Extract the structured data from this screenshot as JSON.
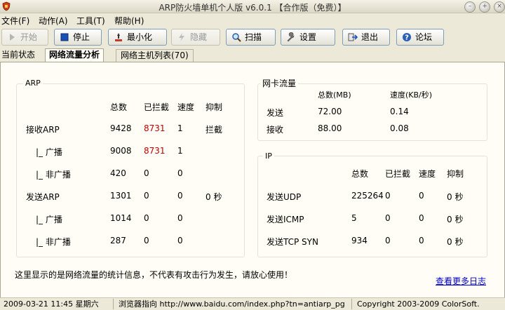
{
  "window": {
    "title": "ARP防火墙单机个人版 v6.0.1 【合作版（免费）】",
    "icons": [
      "shield-logo-icon",
      "minimize-icon",
      "maximize-icon",
      "close-icon"
    ]
  },
  "menu": [
    {
      "label": "文件(F)"
    },
    {
      "label": "动作(A)"
    },
    {
      "label": "工具(T)"
    },
    {
      "label": "帮助(H)"
    }
  ],
  "toolbar": [
    {
      "label": "开始",
      "icon": "play-icon",
      "enabled": false
    },
    {
      "label": "停止",
      "icon": "stop-icon",
      "enabled": true
    },
    {
      "label": "最小化",
      "icon": "minimize-to-tray-icon",
      "enabled": true
    },
    {
      "label": "隐藏",
      "icon": "hide-icon",
      "enabled": false
    },
    {
      "label": "扫描",
      "icon": "magnifier-icon",
      "enabled": true
    },
    {
      "label": "设置",
      "icon": "wrench-icon",
      "enabled": true
    },
    {
      "label": "退出",
      "icon": "exit-icon",
      "enabled": true
    },
    {
      "label": "论坛",
      "icon": "help-icon",
      "enabled": true
    }
  ],
  "tabs": [
    {
      "label": "当前状态",
      "active": false
    },
    {
      "label": "网络流量分析",
      "active": true
    },
    {
      "label": "网络主机列表(70)",
      "active": false
    }
  ],
  "arp": {
    "label": "ARP",
    "headers": [
      "总数",
      "已拦截",
      "速度",
      "抑制"
    ],
    "rows": [
      {
        "name": "接收ARP",
        "total": "9428",
        "blocked": "8731",
        "speed": "1",
        "suppress": "拦截"
      },
      {
        "name": "|_ 广播",
        "total": "9008",
        "blocked": "8731",
        "speed": "1",
        "suppress": ""
      },
      {
        "name": "|_ 非广播",
        "total": "420",
        "blocked": "0",
        "speed": "0",
        "suppress": ""
      },
      {
        "name": "发送ARP",
        "total": "1301",
        "blocked": "0",
        "speed": "0",
        "suppress": "0 秒"
      },
      {
        "name": "|_ 广播",
        "total": "1014",
        "blocked": "0",
        "speed": "0",
        "suppress": ""
      },
      {
        "name": "|_ 非广播",
        "total": "287",
        "blocked": "0",
        "speed": "0",
        "suppress": ""
      }
    ]
  },
  "nic": {
    "label": "网卡流量",
    "headers": [
      "总数(MB)",
      "速度(KB/秒)"
    ],
    "rows": [
      {
        "name": "发送",
        "total": "72.00",
        "speed": "0.14"
      },
      {
        "name": "接收",
        "total": "88.00",
        "speed": "0.08"
      }
    ]
  },
  "ip": {
    "label": "IP",
    "headers": [
      "总数",
      "已拦截",
      "速度",
      "抑制"
    ],
    "rows": [
      {
        "name": "发送UDP",
        "total": "225264",
        "blocked": "0",
        "speed": "0",
        "suppress": "0 秒"
      },
      {
        "name": "发送ICMP",
        "total": "5",
        "blocked": "0",
        "speed": "0",
        "suppress": "0 秒"
      },
      {
        "name": "发送TCP SYN",
        "total": "934",
        "blocked": "0",
        "speed": "0",
        "suppress": "0 秒"
      }
    ]
  },
  "notice": "这里显示的是网络流量的统计信息，不代表有攻击行为发生，请放心使用！",
  "more_logs": "查看更多日志",
  "status": {
    "datetime": "2009-03-21 11:45 星期六",
    "browser": "浏览器指向 http://www.baidu.com/index.php?tn=antiarp_pg",
    "copyright": "Copyright 2003-2009 ColorSoft."
  },
  "colors": {
    "blocked_red": "#c00000",
    "link_blue": "#0000cc"
  }
}
